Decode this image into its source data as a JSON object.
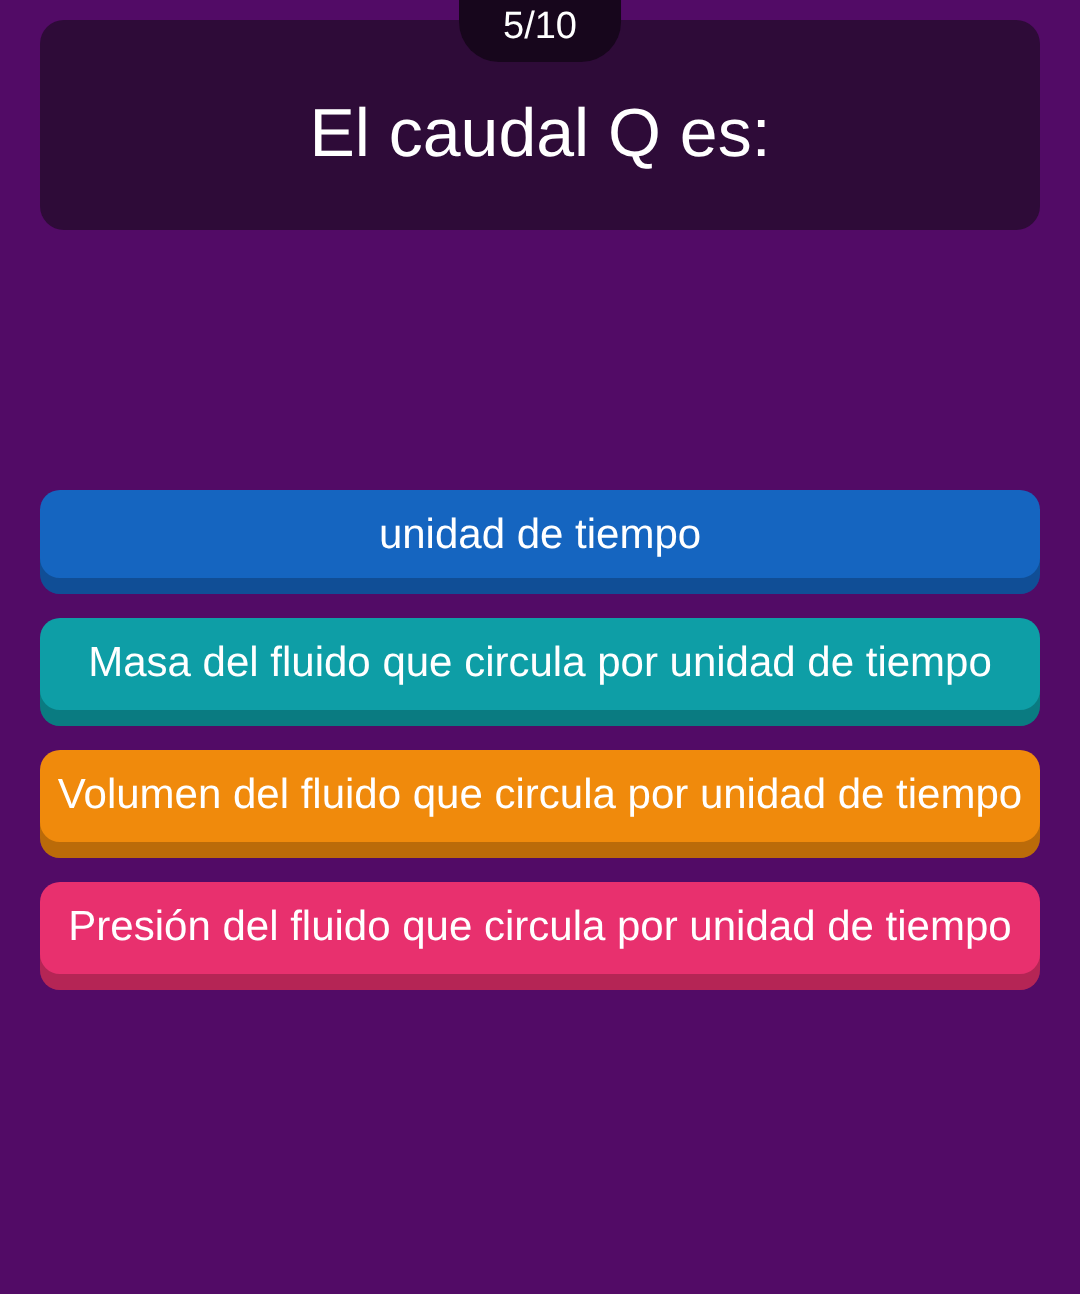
{
  "progress": "5/10",
  "question": "El caudal Q es:",
  "answers": [
    {
      "text": "unidad de tiempo",
      "color": "#1565c0"
    },
    {
      "text": "Masa del fluido que circula por unidad de tiempo",
      "color": "#0e9ea6"
    },
    {
      "text": "Volumen del fluido que circula por unidad de tiempo",
      "color": "#f08a0c"
    },
    {
      "text": "Presión del fluido que circula por unidad de tiempo",
      "color": "#e8306e"
    }
  ]
}
